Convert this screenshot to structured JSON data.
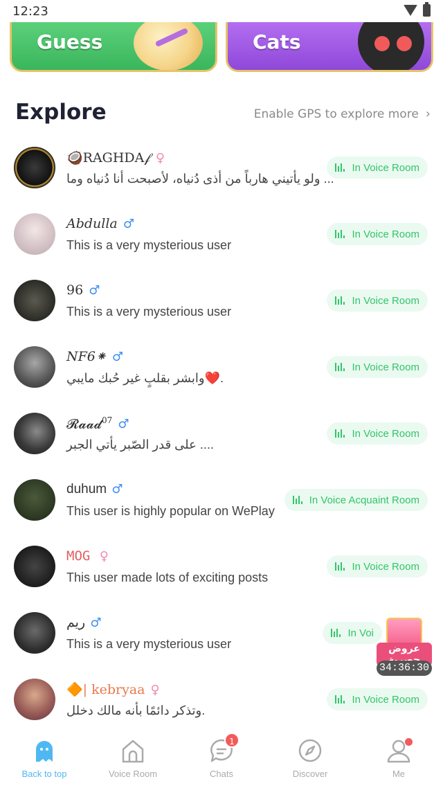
{
  "status_bar": {
    "time": "12:23"
  },
  "banners": [
    {
      "title": "Guess"
    },
    {
      "title": "Cats"
    }
  ],
  "explore": {
    "title": "Explore",
    "gps_link": "Enable GPS to explore more",
    "users": [
      {
        "name": "🥥RAGHDA",
        "name_suffix": "𝒻",
        "gender": "female",
        "bio": "ولو يأتيني هارباً من أذى دُنياه، لأصبحت أنا دُنياه وما ...",
        "status": "In Voice Room"
      },
      {
        "name": "Abdulla",
        "gender": "male",
        "bio": "This is a very mysterious user",
        "status": "In Voice Room"
      },
      {
        "name": "96",
        "gender": "male",
        "bio": "This is a very mysterious user",
        "status": "In Voice Room"
      },
      {
        "name": "NF6⁕",
        "gender": "male",
        "bio": "وابشر بقلبٍ غير حُبك مايبي❤️.",
        "status": "In Voice Room"
      },
      {
        "name": "𝓡𝓪𝓪𝓭",
        "name_suffix": "07",
        "gender": "male",
        "bio": "على قدر الصّبر يأتي الجبر ....",
        "status": "In Voice Room"
      },
      {
        "name": "duhum",
        "gender": "male",
        "bio": "This user is highly popular on WePlay",
        "status": "In Voice Acquaint Room"
      },
      {
        "name": "MOG",
        "gender": "female",
        "bio": "This user made lots of exciting posts",
        "status": "In Voice Room"
      },
      {
        "name": "ريم",
        "gender": "male",
        "bio": "This is a very mysterious user",
        "status": "In Voi"
      },
      {
        "name": "🔶| kebryaa",
        "gender": "female",
        "bio": "وتذكر دائمًا بأنه مالك دخلل.",
        "status": "In Voice Room"
      }
    ],
    "gender_symbols": {
      "male": "♂",
      "female": "♀"
    }
  },
  "promo": {
    "label": "عروض حصرية",
    "timer": "34:36:30"
  },
  "tabs": [
    {
      "label": "Back to top",
      "active": true
    },
    {
      "label": "Voice Room"
    },
    {
      "label": "Chats",
      "badge": "1"
    },
    {
      "label": "Discover"
    },
    {
      "label": "Me"
    }
  ],
  "colors": {
    "accent_green": "#33c46a",
    "active_tab": "#4fb8f3",
    "male": "#3f8ef2",
    "female": "#f08ab5"
  }
}
